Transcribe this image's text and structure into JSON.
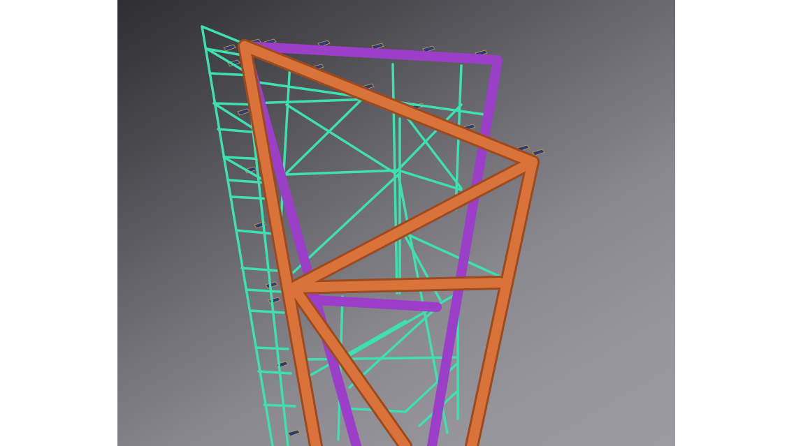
{
  "scene": {
    "kind": "3d-cad-viewport",
    "background_colors": [
      "#2e2e32",
      "#9a9aa0"
    ],
    "member_colors": {
      "bracing": "#3fe0b0",
      "rear_frame": "#9b3fc8",
      "front_frame": "#d9733a",
      "front_frame_edge": "#9c4a1f",
      "brackets": "#2a3d7a"
    }
  }
}
